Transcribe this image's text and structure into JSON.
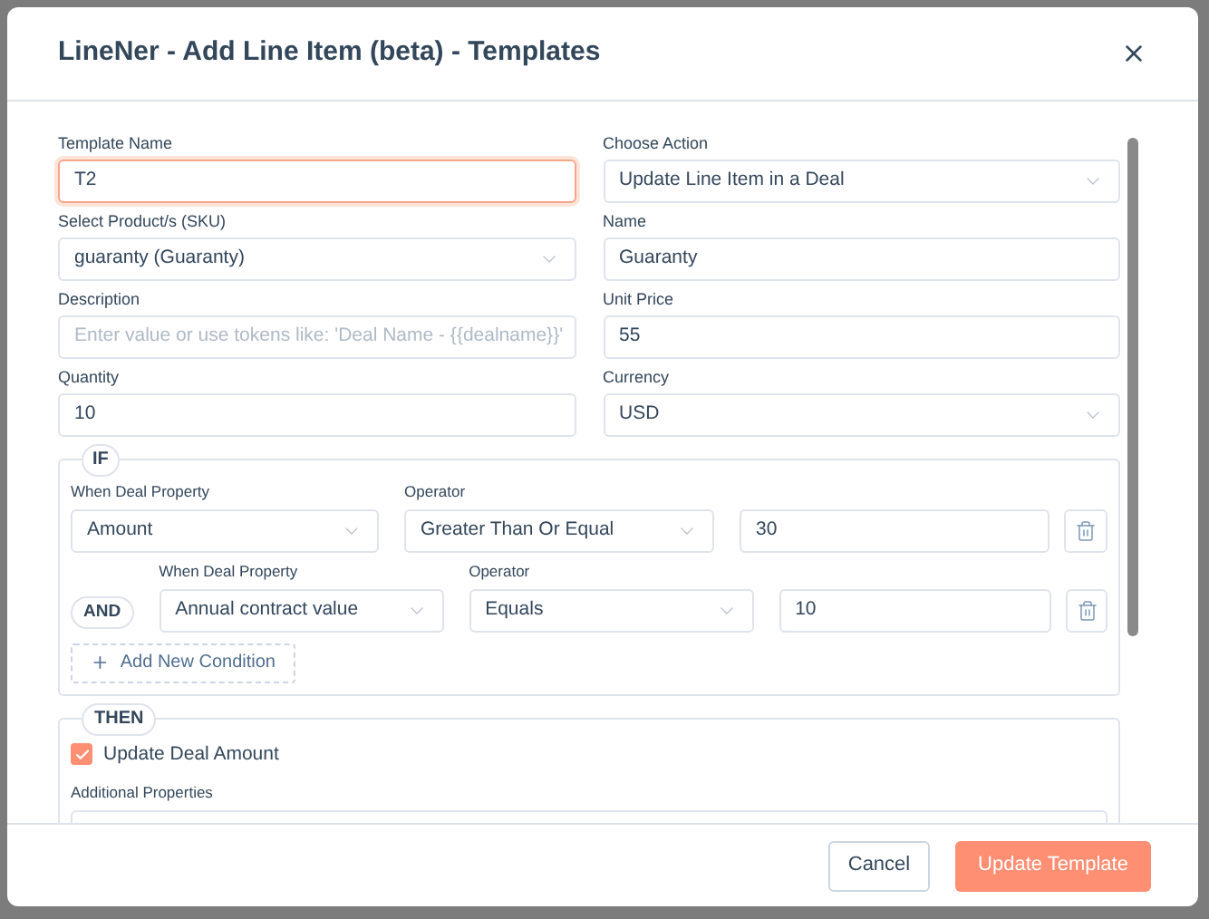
{
  "dialog": {
    "title": "LineNer - Add Line Item (beta) - Templates"
  },
  "fields": [
    {
      "label": "Template Name",
      "kind": "input",
      "value": "T2",
      "focused": true
    },
    {
      "label": "Choose Action",
      "kind": "select",
      "value": "Update Line Item in a Deal",
      "focused": false
    },
    {
      "label": "Select Product/s (SKU)",
      "kind": "select",
      "value": "guaranty (Guaranty)",
      "focused": false
    },
    {
      "label": "Name",
      "kind": "input",
      "value": "Guaranty",
      "focused": false
    },
    {
      "label": "Description",
      "kind": "input",
      "placeholder": "Enter value or use tokens like: 'Deal Name - {{dealname}}'",
      "focused": false
    },
    {
      "label": "Unit Price",
      "kind": "input",
      "value": "55",
      "focused": false
    },
    {
      "label": "Quantity",
      "kind": "input",
      "value": "10",
      "focused": false
    },
    {
      "label": "Currency",
      "kind": "select",
      "value": "USD",
      "focused": false
    }
  ],
  "if_section": {
    "legend": "IF",
    "conditions": [
      {
        "property_label": "When Deal Property",
        "property": "Amount",
        "operator_label": "Operator",
        "operator": "Greater Than Or Equal",
        "value": "30"
      },
      {
        "connector": "AND",
        "property_label": "When Deal Property",
        "property": "Annual contract value",
        "operator_label": "Operator",
        "operator": "Equals",
        "value": "10"
      }
    ],
    "add_button": "Add New Condition"
  },
  "then_section": {
    "legend": "THEN",
    "update_deal_amount": {
      "label": "Update Deal Amount",
      "checked": true
    },
    "additional_label": "Additional Properties"
  },
  "footer": {
    "cancel": "Cancel",
    "submit": "Update Template"
  }
}
